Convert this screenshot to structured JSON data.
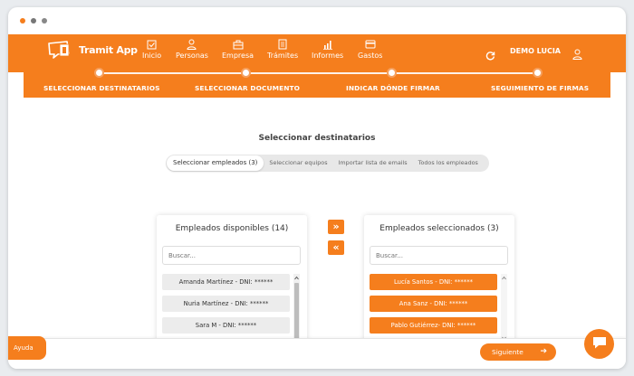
{
  "window": {
    "dots": [
      "#f57e1d",
      "#777777",
      "#888888"
    ]
  },
  "brand": {
    "logo_text": "Tramit App",
    "accent": "#f57e1d"
  },
  "nav": {
    "items": [
      {
        "label": "Inicio",
        "icon": "checkbox-icon"
      },
      {
        "label": "Personas",
        "icon": "person-icon"
      },
      {
        "label": "Empresa",
        "icon": "briefcase-icon"
      },
      {
        "label": "Trámites",
        "icon": "document-icon"
      },
      {
        "label": "Informes",
        "icon": "bar-chart-icon"
      },
      {
        "label": "Gastos",
        "icon": "credit-card-icon"
      }
    ],
    "user_name": "DEMO LUCIA"
  },
  "steps": [
    "SELECCIONAR DESTINATARIOS",
    "SELECCIONAR DOCUMENTO",
    "INDICAR DÓNDE FIRMAR",
    "SEGUIMIENTO DE FIRMAS"
  ],
  "main": {
    "title": "Seleccionar destinatarios",
    "tabs": [
      "Seleccionar empleados (3)",
      "Seleccionar equipos",
      "Importar lista de emails",
      "Todos los empleados"
    ],
    "active_tab": 0
  },
  "available": {
    "title": "Empleados disponibles (14)",
    "search_placeholder": "Buscar...",
    "items": [
      "Amanda Martínez - DNI: ******",
      "Nuria Martínez - DNI: ******",
      "Sara M - DNI: ******",
      ""
    ]
  },
  "selected": {
    "title": "Empleados seleccionados (3)",
    "search_placeholder": "Buscar...",
    "items": [
      "Lucía Santos - DNI: ******",
      "Ana Sanz - DNI: ******",
      "Pablo Gutiérrez- DNI: ******"
    ]
  },
  "buttons": {
    "add_all": "»",
    "remove_all": "«",
    "help": "Ayuda",
    "next": "Siguiente",
    "next_arrow": "➔"
  }
}
